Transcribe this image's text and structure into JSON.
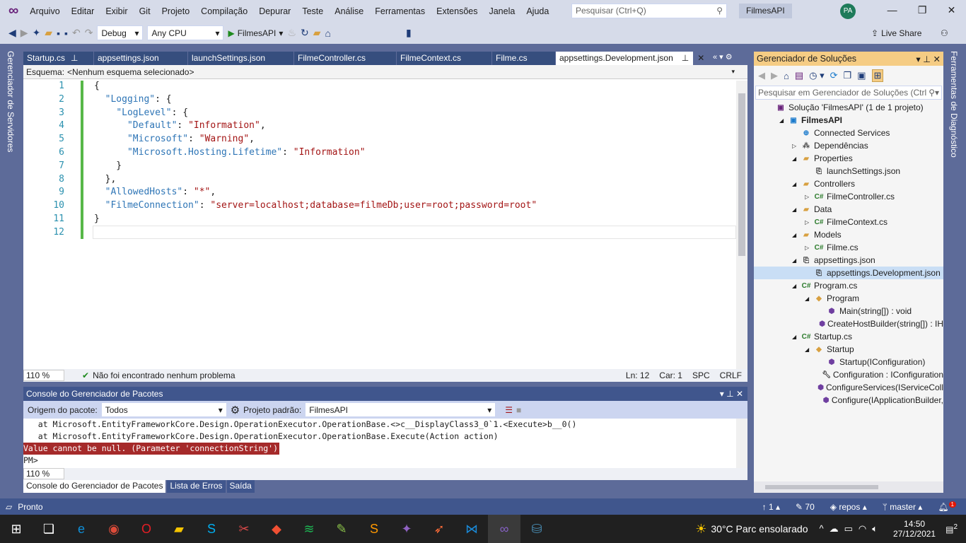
{
  "menu": [
    "Arquivo",
    "Editar",
    "Exibir",
    "Git",
    "Projeto",
    "Compilação",
    "Depurar",
    "Teste",
    "Análise",
    "Ferramentas",
    "Extensões",
    "Janela",
    "Ajuda"
  ],
  "search_placeholder": "Pesquisar (Ctrl+Q)",
  "solution_name": "FilmesAPI",
  "user_initials": "PA",
  "toolbar": {
    "config": "Debug",
    "platform": "Any CPU",
    "run": "FilmesAPI",
    "live_share": "Live Share"
  },
  "left_strip": "Gerenciador de Servidores",
  "right_strip": "Ferramentas de Diagnóstico",
  "tabs": [
    "Startup.cs",
    "appsettings.json",
    "launchSettings.json",
    "FilmeController.cs",
    "FilmeContext.cs",
    "Filme.cs",
    "appsettings.Development.json"
  ],
  "schema": {
    "label": "Esquema:",
    "value": "<Nenhum esquema selecionado>"
  },
  "code_lines": [
    [
      [
        "p",
        "{"
      ]
    ],
    [
      [
        "p",
        "  "
      ],
      [
        "k",
        "\"Logging\""
      ],
      [
        "p",
        ": {"
      ]
    ],
    [
      [
        "p",
        "    "
      ],
      [
        "k",
        "\"LogLevel\""
      ],
      [
        "p",
        ": {"
      ]
    ],
    [
      [
        "p",
        "      "
      ],
      [
        "k",
        "\"Default\""
      ],
      [
        "p",
        ": "
      ],
      [
        "s",
        "\"Information\""
      ],
      [
        "p",
        ","
      ]
    ],
    [
      [
        "p",
        "      "
      ],
      [
        "k",
        "\"Microsoft\""
      ],
      [
        "p",
        ": "
      ],
      [
        "s",
        "\"Warning\""
      ],
      [
        "p",
        ","
      ]
    ],
    [
      [
        "p",
        "      "
      ],
      [
        "k",
        "\"Microsoft.Hosting.Lifetime\""
      ],
      [
        "p",
        ": "
      ],
      [
        "s",
        "\"Information\""
      ]
    ],
    [
      [
        "p",
        "    }"
      ]
    ],
    [
      [
        "p",
        "  },"
      ]
    ],
    [
      [
        "p",
        "  "
      ],
      [
        "k",
        "\"AllowedHosts\""
      ],
      [
        "p",
        ": "
      ],
      [
        "s",
        "\"*\""
      ],
      [
        "p",
        ","
      ]
    ],
    [
      [
        "p",
        "  "
      ],
      [
        "k",
        "\"FilmeConnection\""
      ],
      [
        "p",
        ": "
      ],
      [
        "s",
        "\"server=localhost;database=filmeDb;user=root;password=root\""
      ]
    ],
    [
      [
        "p",
        "}"
      ]
    ],
    [
      [
        "p",
        ""
      ]
    ]
  ],
  "editor_status": {
    "zoom": "110 %",
    "issues": "Não foi encontrado nenhum problema",
    "ln": "Ln: 12",
    "car": "Car: 1",
    "spc": "SPC",
    "crlf": "CRLF"
  },
  "pmc": {
    "title": "Console do Gerenciador de Pacotes",
    "source_label": "Origem do pacote:",
    "source": "Todos",
    "project_label": "Projeto padrão:",
    "project": "FilmesAPI",
    "output": [
      "   at Microsoft.EntityFrameworkCore.Design.OperationExecutor.OperationBase.<>c__DisplayClass3_0`1.<Execute>b__0()",
      "   at Microsoft.EntityFrameworkCore.Design.OperationExecutor.OperationBase.Execute(Action action)"
    ],
    "error": "Value cannot be null. (Parameter 'connectionString')",
    "prompt": "PM>",
    "zoom": "110 %",
    "bottom_tabs": [
      "Console do Gerenciador de Pacotes",
      "Lista de Erros",
      "Saída"
    ]
  },
  "se": {
    "title": "Gerenciador de Soluções",
    "search_placeholder": "Pesquisar em Gerenciador de Soluções (Ctrl",
    "items": [
      {
        "l": 0,
        "t": "Solução 'FilmesAPI' (1 de 1 projeto)",
        "i": "sln",
        "e": ""
      },
      {
        "l": 1,
        "t": "FilmesAPI",
        "i": "proj",
        "e": "◢",
        "b": true
      },
      {
        "l": 2,
        "t": "Connected Services",
        "i": "svc",
        "e": ""
      },
      {
        "l": 2,
        "t": "Dependências",
        "i": "dep",
        "e": "▷"
      },
      {
        "l": 2,
        "t": "Properties",
        "i": "folder",
        "e": "◢"
      },
      {
        "l": 3,
        "t": "launchSettings.json",
        "i": "json",
        "e": ""
      },
      {
        "l": 2,
        "t": "Controllers",
        "i": "folder",
        "e": "◢"
      },
      {
        "l": 3,
        "t": "FilmeController.cs",
        "i": "cs",
        "e": "▷"
      },
      {
        "l": 2,
        "t": "Data",
        "i": "folder",
        "e": "◢"
      },
      {
        "l": 3,
        "t": "FilmeContext.cs",
        "i": "cs",
        "e": "▷"
      },
      {
        "l": 2,
        "t": "Models",
        "i": "folder",
        "e": "◢"
      },
      {
        "l": 3,
        "t": "Filme.cs",
        "i": "cs",
        "e": "▷"
      },
      {
        "l": 2,
        "t": "appsettings.json",
        "i": "json",
        "e": "◢"
      },
      {
        "l": 3,
        "t": "appsettings.Development.json",
        "i": "json",
        "e": "",
        "sel": true
      },
      {
        "l": 2,
        "t": "Program.cs",
        "i": "cs",
        "e": "◢"
      },
      {
        "l": 3,
        "t": "Program",
        "i": "class",
        "e": "◢"
      },
      {
        "l": 4,
        "t": "Main(string[]) : void",
        "i": "method",
        "e": ""
      },
      {
        "l": 4,
        "t": "CreateHostBuilder(string[]) : IH",
        "i": "method",
        "e": ""
      },
      {
        "l": 2,
        "t": "Startup.cs",
        "i": "cs",
        "e": "◢"
      },
      {
        "l": 3,
        "t": "Startup",
        "i": "class",
        "e": "◢"
      },
      {
        "l": 4,
        "t": "Startup(IConfiguration)",
        "i": "method",
        "e": ""
      },
      {
        "l": 4,
        "t": "Configuration : IConfiguration",
        "i": "prop",
        "e": ""
      },
      {
        "l": 4,
        "t": "ConfigureServices(IServiceColl",
        "i": "method",
        "e": ""
      },
      {
        "l": 4,
        "t": "Configure(IApplicationBuilder,",
        "i": "method",
        "e": ""
      }
    ]
  },
  "status": {
    "ready": "Pronto",
    "up": "1",
    "edits": "70",
    "repo": "repos",
    "branch": "master",
    "notif": "1"
  },
  "taskbar": {
    "weather": "30°C  Parc ensolarado",
    "time": "14:50",
    "date": "27/12/2021",
    "notif": "2",
    "apps": [
      "edge",
      "chrome",
      "opera",
      "explorer",
      "skype",
      "snipping",
      "git",
      "spotify",
      "notepad",
      "sublime",
      "sourcetree",
      "postman",
      "vscode",
      "visual-studio",
      "mysql-workbench"
    ]
  }
}
